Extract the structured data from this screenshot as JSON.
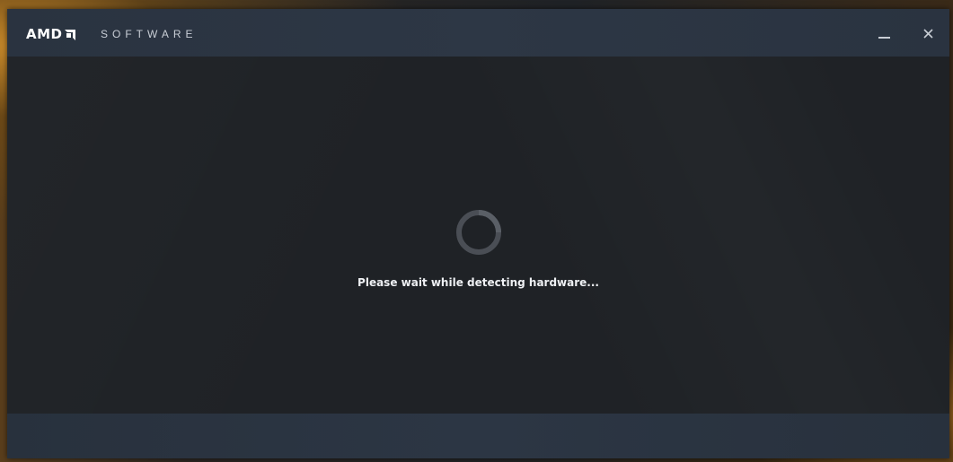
{
  "window": {
    "brand": "AMD",
    "product": "SOFTWARE"
  },
  "titlebar": {
    "minimize_icon": "minimize-icon",
    "close_icon": "close-icon",
    "close_glyph": "✕"
  },
  "main": {
    "spinner_icon": "loading-spinner-icon",
    "status_text": "Please wait while detecting hardware..."
  },
  "colors": {
    "titlebar": "#2d3745",
    "content": "#1f2226",
    "footer": "#2c3644",
    "text": "#eef0f3"
  }
}
